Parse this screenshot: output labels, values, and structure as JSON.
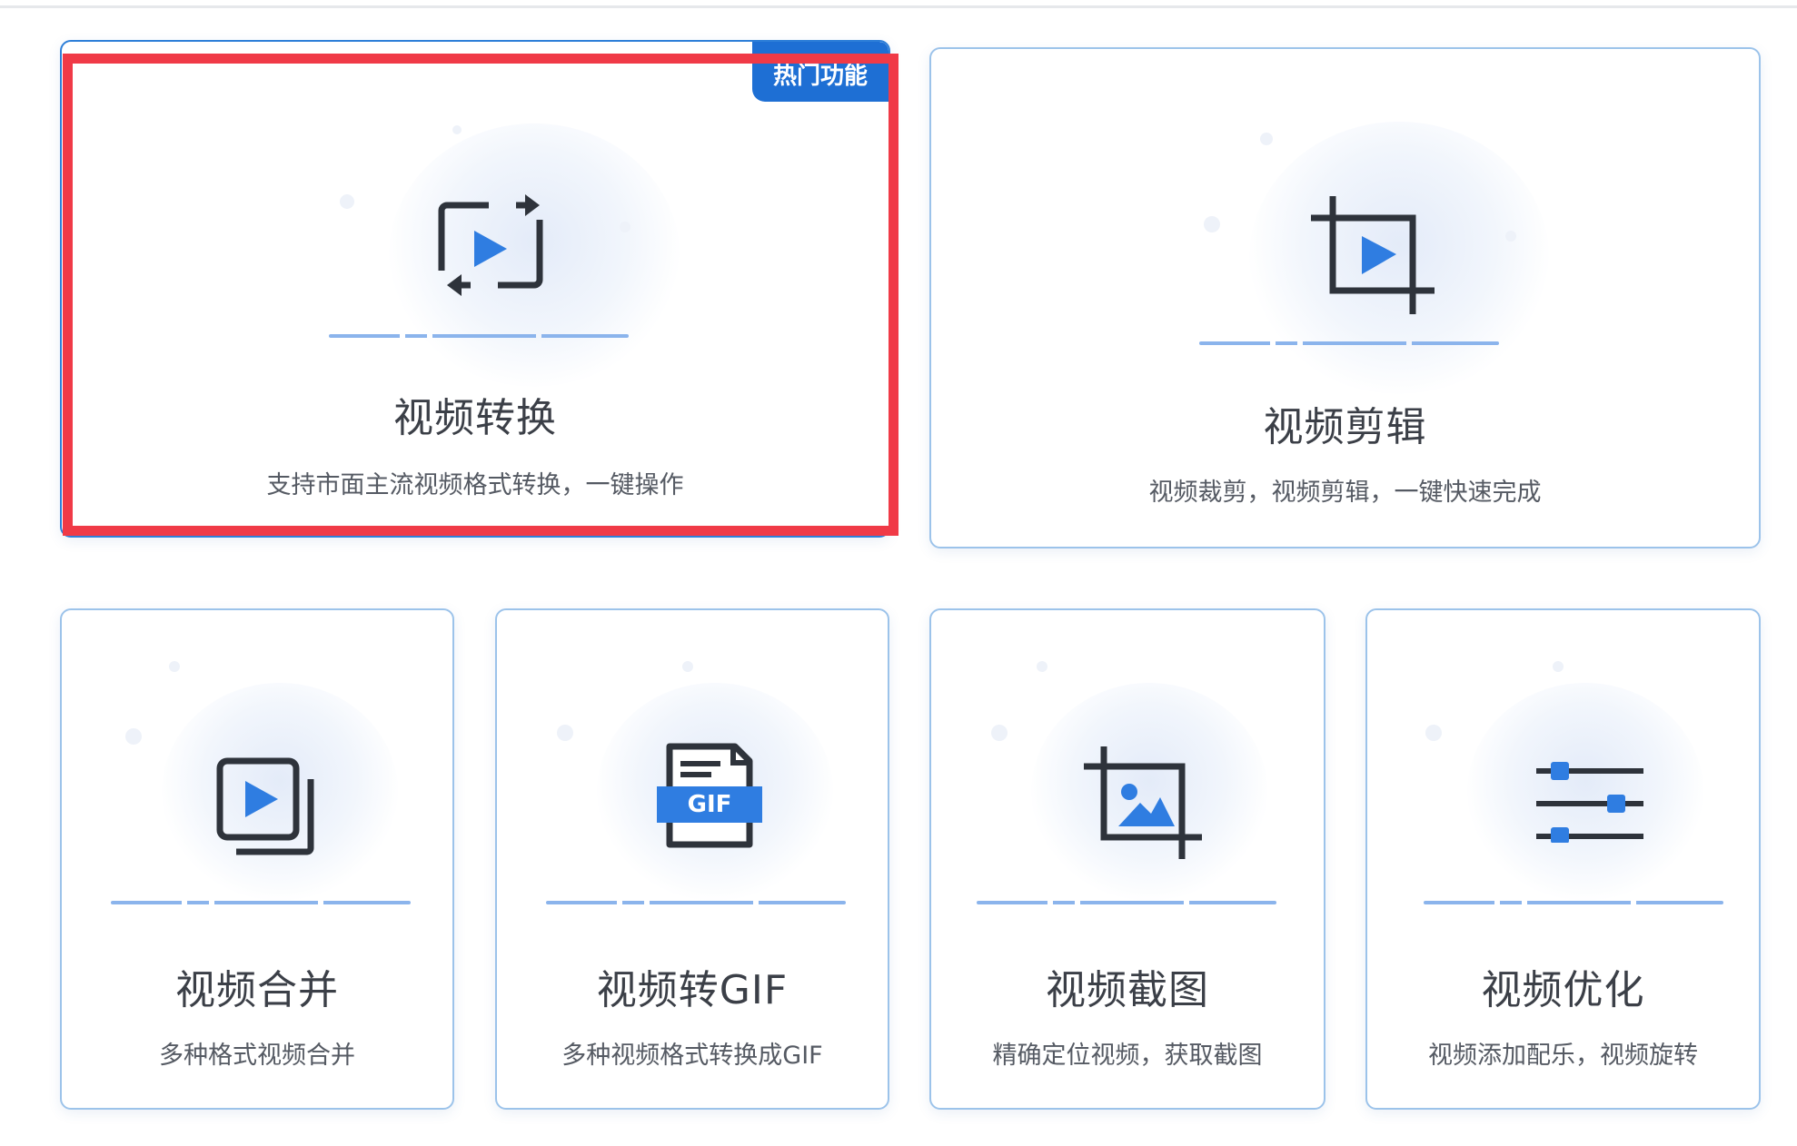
{
  "badge": {
    "hot_label": "热门功能"
  },
  "cards": [
    {
      "title": "视频转换",
      "desc": "支持市面主流视频格式转换，一键操作",
      "icon": "convert-video-icon"
    },
    {
      "title": "视频剪辑",
      "desc": "视频裁剪，视频剪辑，一键快速完成",
      "icon": "crop-video-icon"
    },
    {
      "title": "视频合并",
      "desc": "多种格式视频合并",
      "icon": "merge-video-icon"
    },
    {
      "title": "视频转GIF",
      "desc": "多种视频格式转换成GIF",
      "icon": "gif-icon"
    },
    {
      "title": "视频截图",
      "desc": "精确定位视频，获取截图",
      "icon": "screenshot-icon"
    },
    {
      "title": "视频优化",
      "desc": "视频添加配乐，视频旋转",
      "icon": "sliders-icon"
    }
  ],
  "icon_text": {
    "gif": "GIF"
  },
  "colors": {
    "accent": "#1e6fd4",
    "icon_blue": "#2f7de1",
    "icon_dark": "#2e333b",
    "card_border": "#9cc3ea",
    "highlight": "#f03a47"
  }
}
